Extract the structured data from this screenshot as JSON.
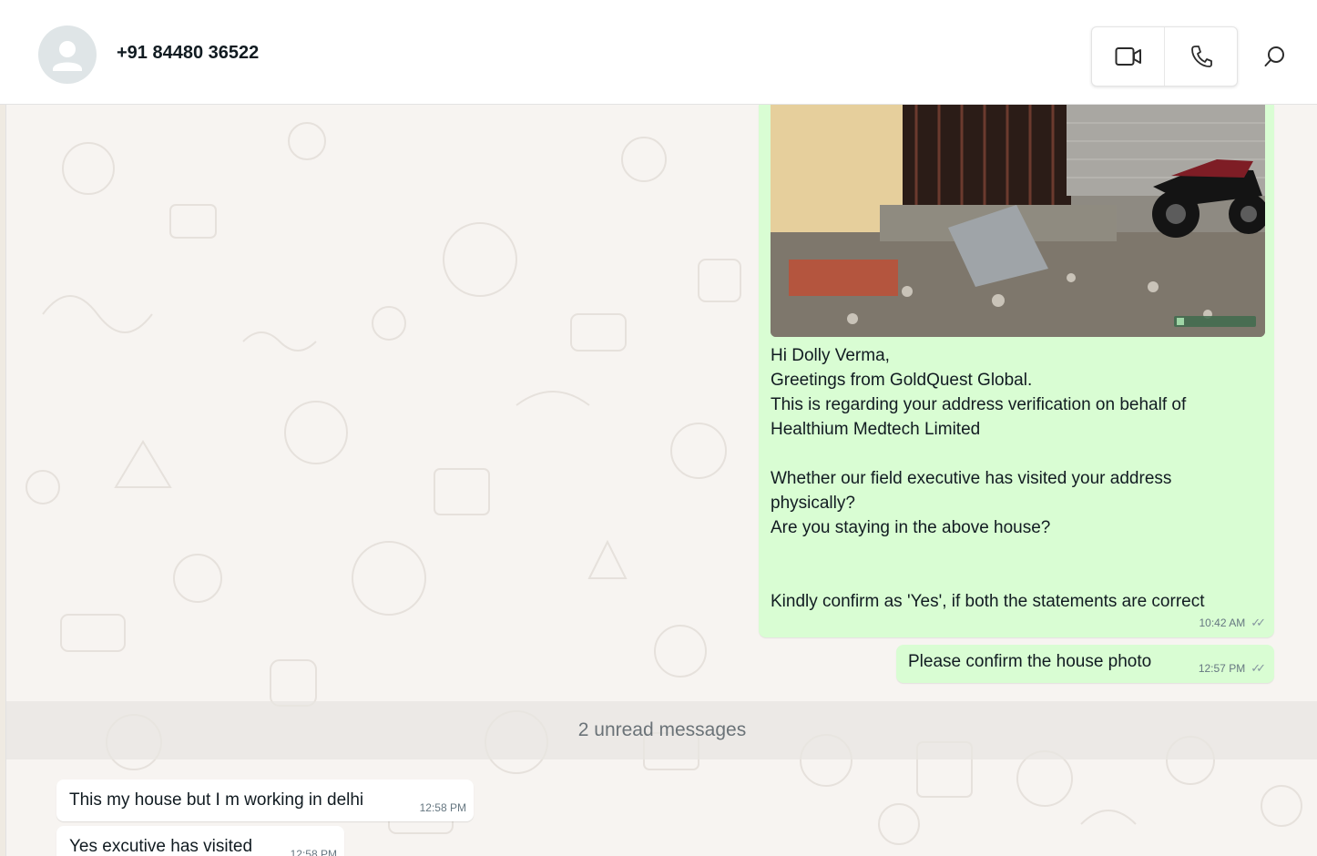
{
  "header": {
    "contact_name": "+91 84480 36522",
    "icons": [
      "avatar-person-icon",
      "video-call-icon",
      "voice-call-icon",
      "search-icon"
    ]
  },
  "messages": [
    {
      "direction": "outgoing",
      "has_image": true,
      "image_watermark": "GPS Map Camera",
      "text": "Hi Dolly Verma,\nGreetings from GoldQuest Global.\nThis is regarding your address verification on behalf of\nHealthium Medtech Limited\n\nWhether our field executive has visited your address\nphysically?\nAre you staying in the above house?\n\n\nKindly confirm as 'Yes', if both the statements are correct",
      "time": "10:42 AM",
      "status": "read"
    },
    {
      "direction": "outgoing",
      "text": "Please confirm the house photo",
      "time": "12:57 PM",
      "status": "read"
    },
    {
      "direction": "incoming",
      "text": "This my house but I m working in delhi",
      "time": "12:58 PM"
    },
    {
      "direction": "incoming",
      "text": "Yes excutive has visited",
      "time": "12:58 PM"
    }
  ],
  "unread_banner": "2 unread messages",
  "colors": {
    "outgoing_bubble": "#d9fdd3",
    "incoming_bubble": "#ffffff",
    "chat_background": "#f7f4f1",
    "header_background": "#ffffff"
  }
}
